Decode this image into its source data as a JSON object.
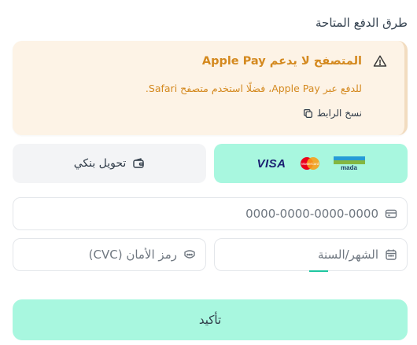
{
  "section_title": "طرق الدفع المتاحة",
  "warning": {
    "title": "المتصفح لا يدعم Apple Pay",
    "text": "للدفع عبر Apple Pay، فضلًا استخدم متصفح Safari.",
    "copy_link": "نسخ الرابط",
    "color": "#d4891f"
  },
  "methods": {
    "cards": {
      "visa": "VISA",
      "mastercard": "MasterCard",
      "mada": "mada"
    },
    "bank_transfer": "تحويل بنكي"
  },
  "form": {
    "card_number_placeholder": "0000-0000-0000-0000",
    "expiry_placeholder": "الشهر/السنة",
    "cvc_placeholder": "رمز الأمان (CVC)"
  },
  "confirm_label": "تأكيد",
  "colors": {
    "accent": "#a8f7df",
    "warning_bg": "#fdf3e6",
    "border": "#e3e6ea"
  }
}
